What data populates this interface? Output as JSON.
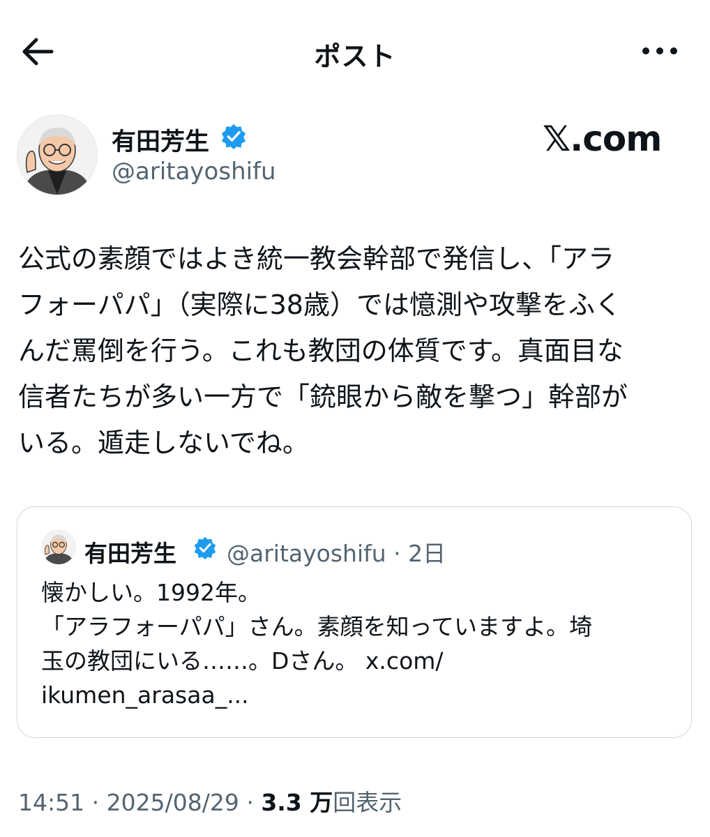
{
  "header": {
    "title": "ポスト"
  },
  "author": {
    "display_name": "有田芳生",
    "handle": "@aritayoshifu",
    "verified": true
  },
  "watermark": "𝕏.com",
  "post": {
    "text": "公式の素顔ではよき統一教会幹部で発信し、「アラ\nフォーパパ」（実際に38歳）では憶測や攻撃をふく\nんだ罵倒を行う。これも教団の体質です。真面目な\n信者たちが多い一方で「銃眼から敵を撃つ」幹部が\nいる。遁走しないでね。"
  },
  "quote": {
    "display_name": "有田芳生",
    "handle": "@aritayoshifu",
    "separator": "·",
    "time_ago": "2日",
    "text": "懐かしい。1992年。\n「アラフォーパパ」さん。素顔を知っていますよ。埼\n玉の教団にいる……。Dさん。 x.com/\nikumen_arasaa_..."
  },
  "footer": {
    "time": "14:51",
    "date": "2025/08/29",
    "separator": "·",
    "views": "3.3 万",
    "views_label": "回表示"
  },
  "colors": {
    "verified_blue": "#1d9bf0",
    "secondary_text": "#536471",
    "border": "#cfd9de"
  }
}
